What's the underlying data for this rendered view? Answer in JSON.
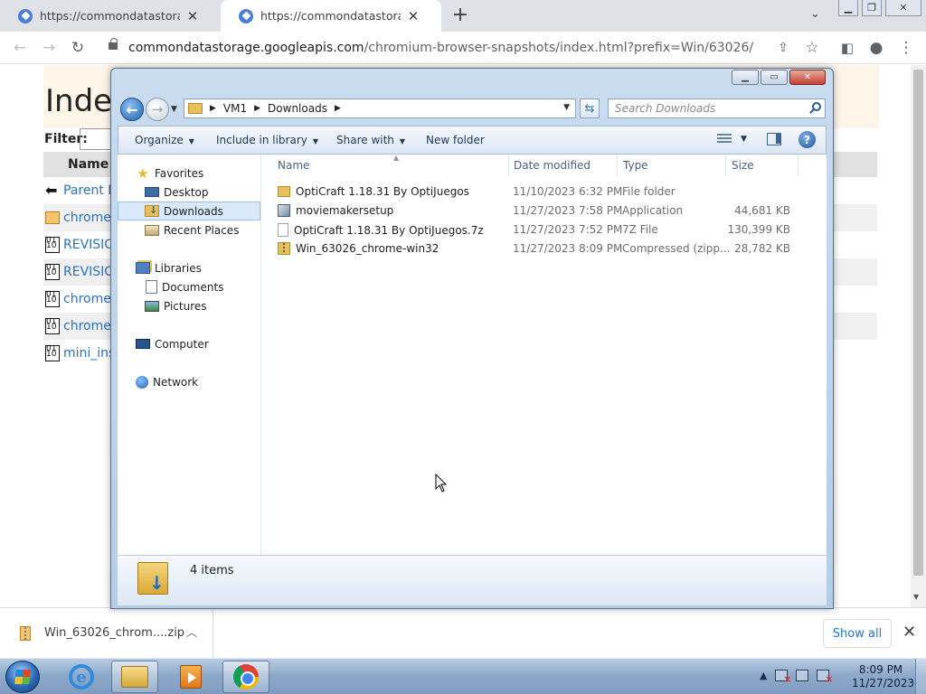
{
  "chrome": {
    "tabs": [
      {
        "title": "https://commondatastorage.goo",
        "active": false
      },
      {
        "title": "https://commondatastorage.goo",
        "active": true
      }
    ],
    "new_tab_icon": "plus-icon",
    "url_host": "commondatastorage.googleapis.com",
    "url_path": "/chromium-browser-snapshots/index.html?prefix=Win/63026/"
  },
  "page": {
    "title": "Index",
    "filter_label": "Filter:",
    "column_name": "Name",
    "rows": [
      {
        "text": "Parent D",
        "icon": "up-icon"
      },
      {
        "text": "chrome-",
        "icon": "folder-icon"
      },
      {
        "text": "REVISIC",
        "icon": "binary-icon"
      },
      {
        "text": "REVISIC",
        "icon": "binary-icon"
      },
      {
        "text": "chrome-",
        "icon": "binary-icon"
      },
      {
        "text": "chrome-",
        "icon": "binary-icon"
      },
      {
        "text": "mini_ins",
        "icon": "binary-icon"
      }
    ]
  },
  "explorer": {
    "breadcrumb": [
      "VM1",
      "Downloads"
    ],
    "search_placeholder": "Search Downloads",
    "commands": {
      "organize": "Organize",
      "include_in_library": "Include in library",
      "share_with": "Share with",
      "new_folder": "New folder"
    },
    "nav": {
      "favorites": "Favorites",
      "desktop": "Desktop",
      "downloads": "Downloads",
      "recent_places": "Recent Places",
      "libraries": "Libraries",
      "documents": "Documents",
      "pictures": "Pictures",
      "computer": "Computer",
      "network": "Network"
    },
    "columns": {
      "name": "Name",
      "date_modified": "Date modified",
      "type": "Type",
      "size": "Size"
    },
    "files": [
      {
        "name": "OptiCraft 1.18.31 By OptiJuegos",
        "date": "11/10/2023 6:32 PM",
        "type": "File folder",
        "size": "",
        "icon": "folder-icon"
      },
      {
        "name": "moviemakersetup",
        "date": "11/27/2023 7:58 PM",
        "type": "Application",
        "size": "44,681 KB",
        "icon": "application-icon"
      },
      {
        "name": "OptiCraft 1.18.31 By OptiJuegos.7z",
        "date": "11/27/2023 7:52 PM",
        "type": "7Z File",
        "size": "130,399 KB",
        "icon": "file-icon"
      },
      {
        "name": "Win_63026_chrome-win32",
        "date": "11/27/2023 8:09 PM",
        "type": "Compressed (zipp...",
        "size": "28,782 KB",
        "icon": "zip-folder-icon"
      }
    ],
    "item_count": "4 items"
  },
  "downloads_bar": {
    "file_name": "Win_63026_chrom....zip",
    "show_all": "Show all"
  },
  "taskbar": {
    "time": "8:09 PM",
    "date": "11/27/2023"
  }
}
